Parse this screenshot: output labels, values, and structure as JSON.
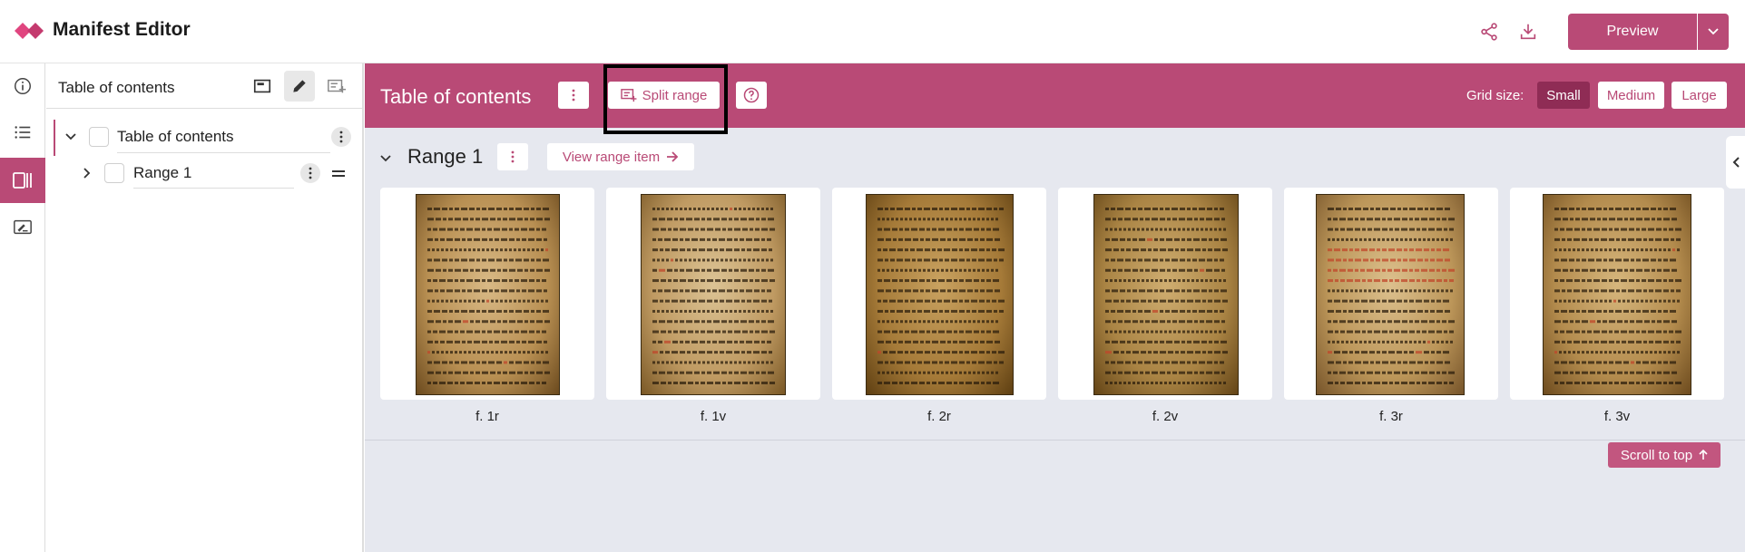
{
  "app": {
    "title": "Manifest Editor"
  },
  "topbar": {
    "share_icon": "share-icon",
    "download_icon": "download-icon",
    "preview_label": "Preview",
    "accent_color": "#b94a76"
  },
  "rail": {
    "items": [
      {
        "icon": "info-icon",
        "active": false
      },
      {
        "icon": "list-icon",
        "active": false
      },
      {
        "icon": "range-panel-icon",
        "active": true
      },
      {
        "icon": "annotation-icon",
        "active": false
      }
    ]
  },
  "left_panel": {
    "title": "Table of contents",
    "tree": [
      {
        "label": "Table of contents",
        "expanded": true
      },
      {
        "label": "Range 1",
        "expanded": false
      }
    ]
  },
  "main": {
    "title": "Table of contents",
    "split_range_label": "Split range",
    "grid_size_label": "Grid size:",
    "grid_sizes": [
      "Small",
      "Medium",
      "Large"
    ],
    "selected_grid_size": "Small",
    "range_title": "Range 1",
    "view_range_label": "View range item",
    "scroll_top_label": "Scroll to top",
    "canvases": [
      {
        "label": "f. 1r"
      },
      {
        "label": "f. 1v"
      },
      {
        "label": "f. 2r"
      },
      {
        "label": "f. 2v"
      },
      {
        "label": "f. 3r"
      },
      {
        "label": "f. 3v"
      }
    ]
  }
}
